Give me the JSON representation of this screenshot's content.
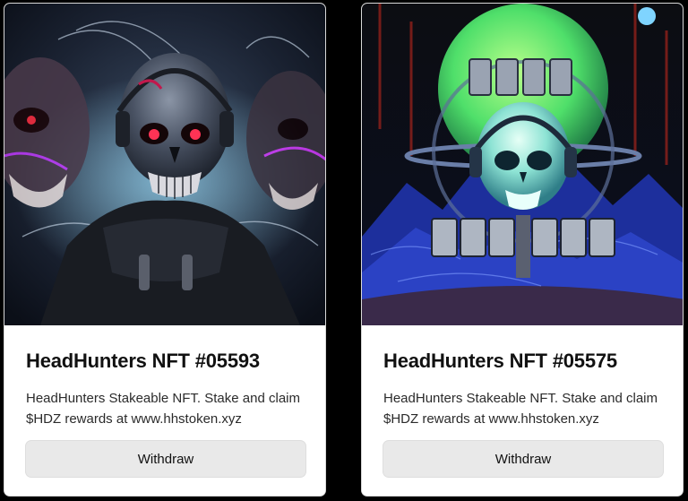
{
  "cards": [
    {
      "title": "HeadHunters NFT #05593",
      "description": "HeadHunters Stakeable NFT. Stake and claim $HDZ rewards at www.hhstoken.xyz",
      "button_label": "Withdraw",
      "image": "cyber-skull-headphones-artwork"
    },
    {
      "title": "HeadHunters NFT #05575",
      "description": "HeadHunters Stakeable NFT. Stake and claim $HDZ rewards at www.hhstoken.xyz",
      "button_label": "Withdraw",
      "image": "skull-moon-logo-artwork"
    }
  ],
  "colors": {
    "page_background": "#000000",
    "card_background": "#ffffff",
    "button_background": "#e9e9e9",
    "title_text": "#111111"
  }
}
